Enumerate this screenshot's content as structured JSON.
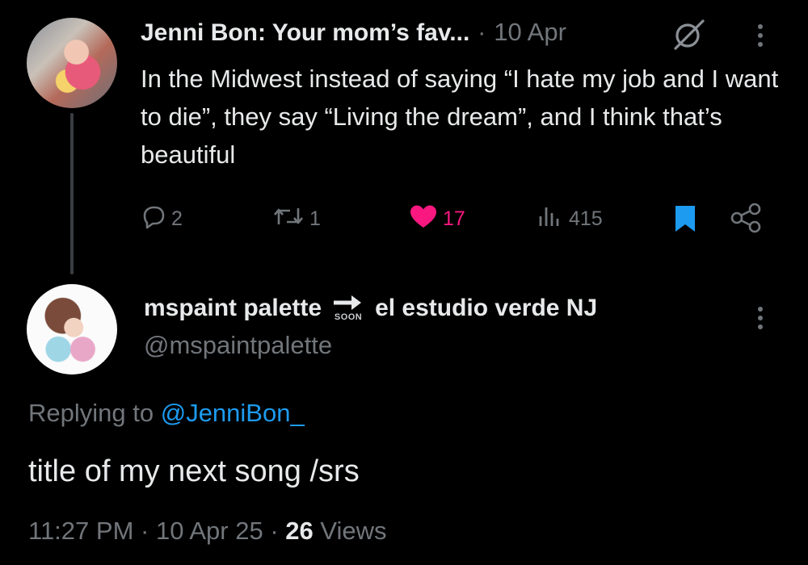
{
  "parent": {
    "author_name": "Jenni Bon: Your mom’s fav...",
    "separator": "·",
    "date": "10 Apr",
    "text": "In the Midwest instead of saying “I hate my job and I want to die”, they say “Living the dream”, and I think that’s beautiful",
    "replies": "2",
    "reposts": "1",
    "likes": "17",
    "views": "415"
  },
  "reply": {
    "name_part1": "mspaint palette",
    "soon_badge": "SOON",
    "name_part2": "el estudio verde NJ",
    "handle": "@mspaintpalette",
    "replying_to_label": "Replying to",
    "replying_to_handle": "@JenniBon_",
    "text": "title of my next song /srs",
    "time": "11:27 PM",
    "date": "10 Apr 25",
    "views_count": "26",
    "views_label": "Views"
  },
  "colors": {
    "background": "#000000",
    "text": "#e7e9ea",
    "muted": "#71767b",
    "link": "#1d9bf0",
    "like": "#f91880"
  },
  "icons": [
    "grok-icon",
    "more-icon",
    "reply-icon",
    "repost-icon",
    "heart-icon",
    "views-icon",
    "bookmark-icon",
    "share-icon",
    "arrow-right-icon"
  ]
}
